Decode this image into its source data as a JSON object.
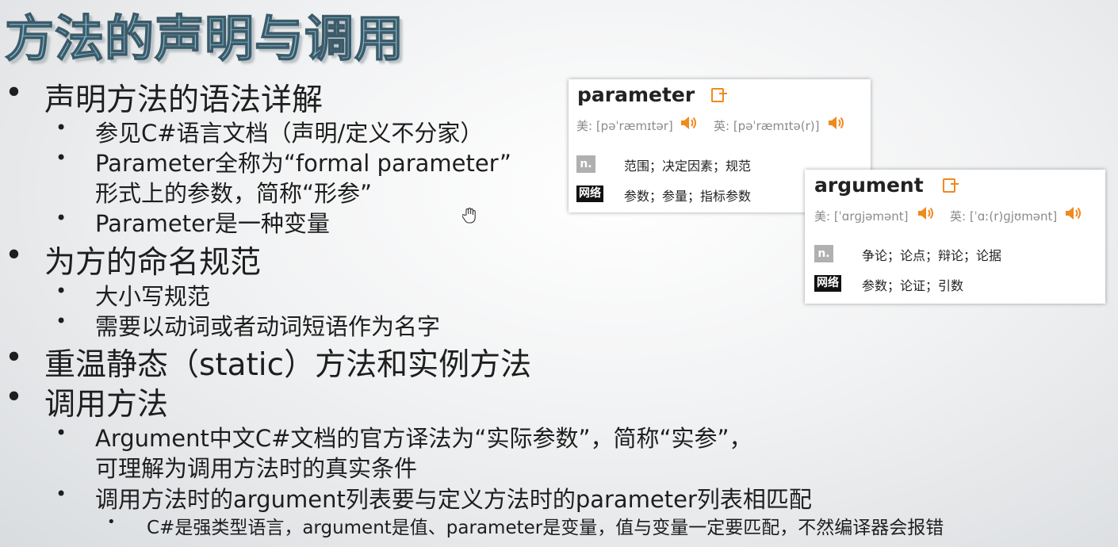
{
  "title": "方法的声明与调用",
  "items": [
    {
      "text": "声明方法的语法详解"
    },
    {
      "text": "参见C#语言文档（声明/定义不分家）"
    },
    {
      "text": "Parameter全称为“formal parameter”"
    },
    {
      "text": "形式上的参数，简称“形参”"
    },
    {
      "text": "Parameter是一种变量"
    },
    {
      "text": "为方的命名规范"
    },
    {
      "text": "大小写规范"
    },
    {
      "text": "需要以动词或者动词短语作为名字"
    },
    {
      "text": "重温静态（static）方法和实例方法"
    },
    {
      "text": "调用方法"
    },
    {
      "text": "Argument中文C#文档的官方译法为“实际参数”，简称“实参”，"
    },
    {
      "text": "可理解为调用方法时的真实条件"
    },
    {
      "text": "调用方法时的argument列表要与定义方法时的parameter列表相匹配"
    },
    {
      "text": "C#是强类型语言，argument是值、parameter是变量，值与变量一定要匹配，不然编译器会报错"
    }
  ],
  "bullets": {
    "l1": "•",
    "l2": "•",
    "l3": "•"
  },
  "dict_parameter": {
    "word": "parameter",
    "us": "美: [pəˈræmɪtər]",
    "uk": "英: [pəˈræmɪtə(r)]",
    "pos": "n.",
    "pos_def": "范围；决定因素；规范",
    "net": "网络",
    "net_def": "参数；参量；指标参数"
  },
  "dict_argument": {
    "word": "argument",
    "us": "美: [ˈɑrɡjəmənt]",
    "uk": "英: [ˈɑː(r)ɡjʊmənt]",
    "pos": "n.",
    "pos_def": "争论；论点；辩论；论据",
    "net": "网络",
    "net_def": "参数；论证；引数"
  },
  "colors": {
    "accent_orange": "#f08a1e",
    "title_fill": "#7bbbd2",
    "title_stroke": "#3e5a68"
  },
  "icons": [
    "add-wordbook-icon",
    "speaker-icon",
    "hand-cursor-icon"
  ]
}
